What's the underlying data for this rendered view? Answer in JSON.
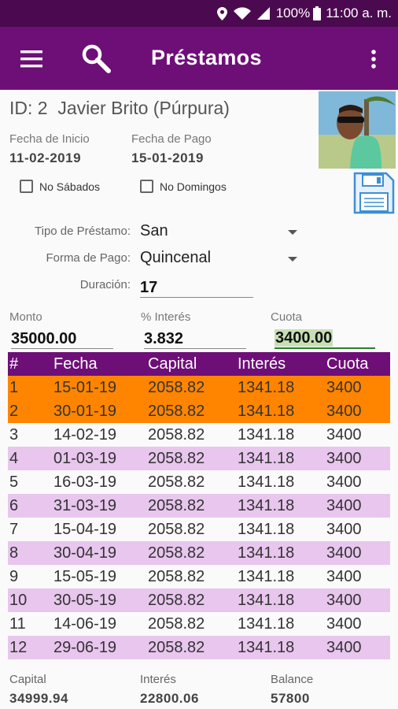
{
  "status": {
    "battery_pct": "100%",
    "time": "11:00 a. m."
  },
  "appbar": {
    "title": "Préstamos"
  },
  "client": {
    "id_label": "ID: 2",
    "name": "Javier Brito (Púrpura)"
  },
  "dates": {
    "start_label": "Fecha de Inicio",
    "start_value": "11-02-2019",
    "pay_label": "Fecha de Pago",
    "pay_value": "15-01-2019"
  },
  "options": {
    "no_saturdays": "No Sábados",
    "no_sundays": "No Domingos"
  },
  "form": {
    "loan_type_label": "Tipo de Préstamo:",
    "loan_type_value": "San",
    "pay_form_label": "Forma de Pago:",
    "pay_form_value": "Quincenal",
    "duration_label": "Duración:",
    "duration_value": "17"
  },
  "amounts": {
    "monto_label": "Monto",
    "monto_value": "35000.00",
    "interest_label": "% Interés",
    "interest_value": "3.832",
    "cuota_label": "Cuota",
    "cuota_value": "3400.00"
  },
  "table": {
    "headers": [
      "#",
      "Fecha",
      "Capital",
      "Interés",
      "Cuota"
    ],
    "rows": [
      [
        "1",
        "15-01-19",
        "2058.82",
        "1341.18",
        "3400"
      ],
      [
        "2",
        "30-01-19",
        "2058.82",
        "1341.18",
        "3400"
      ],
      [
        "3",
        "14-02-19",
        "2058.82",
        "1341.18",
        "3400"
      ],
      [
        "4",
        "01-03-19",
        "2058.82",
        "1341.18",
        "3400"
      ],
      [
        "5",
        "16-03-19",
        "2058.82",
        "1341.18",
        "3400"
      ],
      [
        "6",
        "31-03-19",
        "2058.82",
        "1341.18",
        "3400"
      ],
      [
        "7",
        "15-04-19",
        "2058.82",
        "1341.18",
        "3400"
      ],
      [
        "8",
        "30-04-19",
        "2058.82",
        "1341.18",
        "3400"
      ],
      [
        "9",
        "15-05-19",
        "2058.82",
        "1341.18",
        "3400"
      ],
      [
        "10",
        "30-05-19",
        "2058.82",
        "1341.18",
        "3400"
      ],
      [
        "11",
        "14-06-19",
        "2058.82",
        "1341.18",
        "3400"
      ],
      [
        "12",
        "29-06-19",
        "2058.82",
        "1341.18",
        "3400"
      ]
    ]
  },
  "footer": {
    "capital_label": "Capital",
    "capital_value": "34999.94",
    "interest_label": "Interés",
    "interest_value": "22800.06",
    "balance_label": "Balance",
    "balance_value": "57800"
  },
  "colors": {
    "primary": "#6e0f78",
    "statusbar": "#4b0a4f",
    "selected_row": "#ff8500",
    "alt_row": "#e8c6ee"
  }
}
